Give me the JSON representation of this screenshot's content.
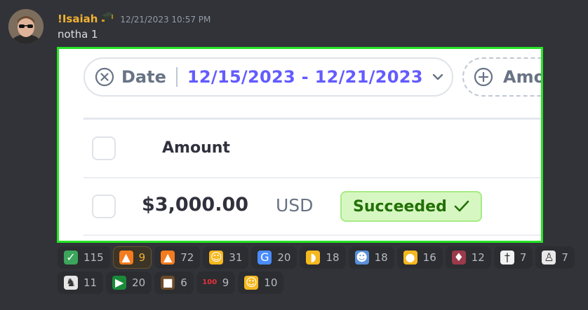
{
  "message": {
    "username": "!Isaiah",
    "timestamp": "12/21/2023 10:57 PM",
    "text": "notha 1"
  },
  "embed": {
    "filter": {
      "label": "Date",
      "value": "12/15/2023 - 12/21/2023"
    },
    "filter2_label": "Amo",
    "column_header": "Amount",
    "row": {
      "amount": "$3,000.00",
      "currency": "USD",
      "status": "Succeeded"
    }
  },
  "reactions": [
    [
      {
        "emoji": "check-mark-button",
        "glyph": "✓",
        "bg": "#3ba55c",
        "count": "115",
        "active": false
      },
      {
        "emoji": "fire",
        "glyph": "▲",
        "bg": "#f57b1f",
        "count": "9",
        "active": true
      },
      {
        "emoji": "fire",
        "glyph": "▲",
        "bg": "#f57b1f",
        "count": "72",
        "active": false
      },
      {
        "emoji": "saluting-face",
        "glyph": "☺",
        "bg": "#f5b81f",
        "count": "31",
        "active": false
      },
      {
        "emoji": "g-letter",
        "glyph": "G",
        "bg": "#4a8cff",
        "count": "20",
        "active": false
      },
      {
        "emoji": "flexed-biceps",
        "glyph": "◗",
        "bg": "#f5b81f",
        "count": "18",
        "active": false
      },
      {
        "emoji": "custom-blue-face",
        "glyph": "☻",
        "bg": "#5a8fd9",
        "count": "18",
        "active": false
      },
      {
        "emoji": "oncoming-fist",
        "glyph": "●",
        "bg": "#f5b81f",
        "count": "16",
        "active": false
      },
      {
        "emoji": "custom-person-photo",
        "glyph": "♦",
        "bg": "#9b3a4a",
        "count": "12",
        "active": false
      },
      {
        "emoji": "custom-stick-figure",
        "glyph": "†",
        "bg": "#f2f2f2",
        "count": "7",
        "active": false
      },
      {
        "emoji": "custom-sketch",
        "glyph": "♙",
        "bg": "#e8e8e8",
        "count": "7",
        "active": false
      }
    ],
    [
      {
        "emoji": "goat",
        "glyph": "♞",
        "bg": "#e6e6e6",
        "count": "11",
        "active": false
      },
      {
        "emoji": "palestine-flag",
        "glyph": "▶",
        "bg": "#1a8a3a",
        "count": "20",
        "active": false
      },
      {
        "emoji": "custom-image",
        "glyph": "■",
        "bg": "#6a4a2a",
        "count": "6",
        "active": false
      },
      {
        "emoji": "hundred-points",
        "glyph": "100",
        "bg": "#2b2d31",
        "count": "9",
        "active": false
      },
      {
        "emoji": "smiling-face-with-sunglasses",
        "glyph": "☺",
        "bg": "#f5b81f",
        "count": "10",
        "active": false
      }
    ]
  ]
}
